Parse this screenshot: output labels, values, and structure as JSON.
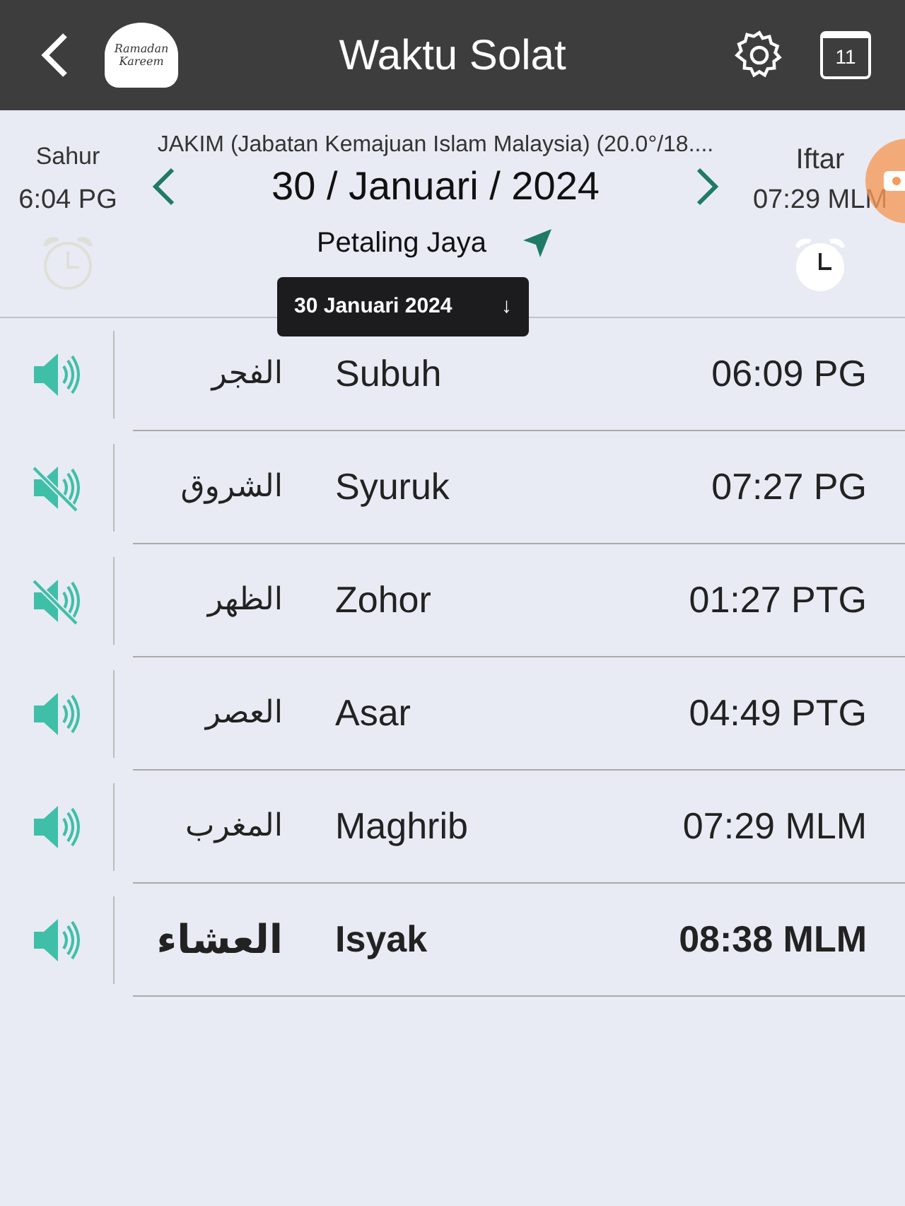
{
  "header": {
    "title": "Waktu Solat",
    "logo_lines": [
      "Ramadan",
      "Kareem"
    ],
    "calendar_day": "11"
  },
  "method": "JAKIM (Jabatan Kemajuan Islam Malaysia) (20.0°/18....",
  "sahur": {
    "label": "Sahur",
    "time": "6:04 PG",
    "alarm_on": false
  },
  "iftar": {
    "label": "Iftar",
    "time": "07:29 MLM",
    "alarm_on": true
  },
  "date": "30 / Januari / 2024",
  "location": "Petaling Jaya",
  "tooltip": {
    "text": "30 Januari 2024",
    "arrow": "↓"
  },
  "prayers": [
    {
      "arabic": "الفجر",
      "name": "Subuh",
      "time": "06:09 PG",
      "sound_on": true,
      "selected": false
    },
    {
      "arabic": "الشروق",
      "name": "Syuruk",
      "time": "07:27 PG",
      "sound_on": false,
      "selected": false
    },
    {
      "arabic": "الظهر",
      "name": "Zohor",
      "time": "01:27 PTG",
      "sound_on": false,
      "selected": false
    },
    {
      "arabic": "العصر",
      "name": "Asar",
      "time": "04:49 PTG",
      "sound_on": true,
      "selected": false
    },
    {
      "arabic": "المغرب",
      "name": "Maghrib",
      "time": "07:29 MLM",
      "sound_on": true,
      "selected": false
    },
    {
      "arabic": "العشاء",
      "name": "Isyak",
      "time": "08:38 MLM",
      "sound_on": true,
      "selected": true
    }
  ]
}
